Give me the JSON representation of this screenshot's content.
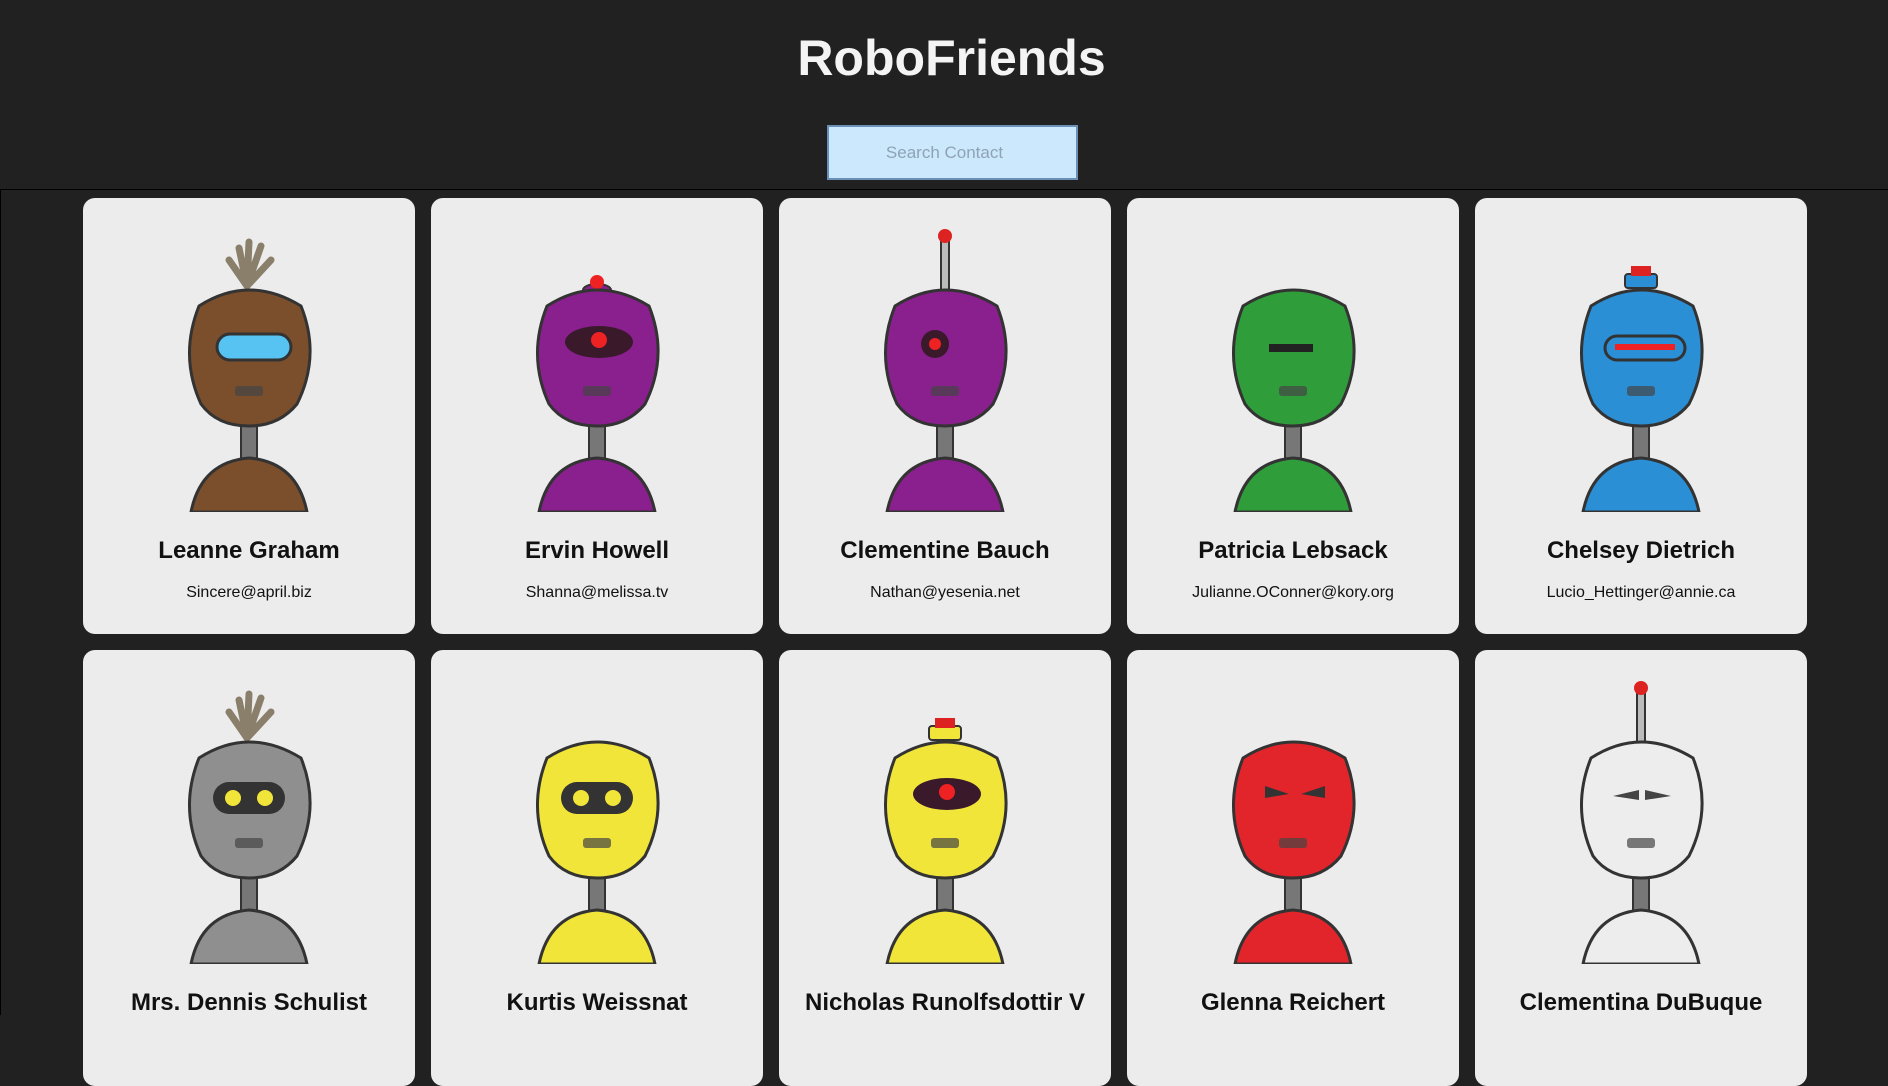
{
  "app": {
    "title": "RoboFriends"
  },
  "search": {
    "placeholder": "Search Contact",
    "value": ""
  },
  "robots": [
    {
      "name": "Leanne Graham",
      "email": "Sincere@april.biz",
      "color": "#7b4f2c",
      "antenna": "hair",
      "eye": "visor-blue"
    },
    {
      "name": "Ervin Howell",
      "email": "Shanna@melissa.tv",
      "color": "#8a1f8e",
      "antenna": "knob",
      "eye": "cyclops"
    },
    {
      "name": "Clementine Bauch",
      "email": "Nathan@yesenia.net",
      "color": "#8a1f8e",
      "antenna": "rod",
      "eye": "single"
    },
    {
      "name": "Patricia Lebsack",
      "email": "Julianne.OConner@kory.org",
      "color": "#2f9e3a",
      "antenna": "none",
      "eye": "slit"
    },
    {
      "name": "Chelsey Dietrich",
      "email": "Lucio_Hettinger@annie.ca",
      "color": "#2b8fd6",
      "antenna": "cap",
      "eye": "visor-red"
    },
    {
      "name": "Mrs. Dennis Schulist",
      "email": "",
      "color": "#8f8f8f",
      "antenna": "hair",
      "eye": "double"
    },
    {
      "name": "Kurtis Weissnat",
      "email": "",
      "color": "#f2e53a",
      "antenna": "none",
      "eye": "double"
    },
    {
      "name": "Nicholas Runolfsdottir V",
      "email": "",
      "color": "#f2e53a",
      "antenna": "cap",
      "eye": "cyclops"
    },
    {
      "name": "Glenna Reichert",
      "email": "",
      "color": "#e2252b",
      "antenna": "none",
      "eye": "angry"
    },
    {
      "name": "Clementina DuBuque",
      "email": "",
      "color": "#ededed",
      "antenna": "rod",
      "eye": "sleepy"
    }
  ]
}
